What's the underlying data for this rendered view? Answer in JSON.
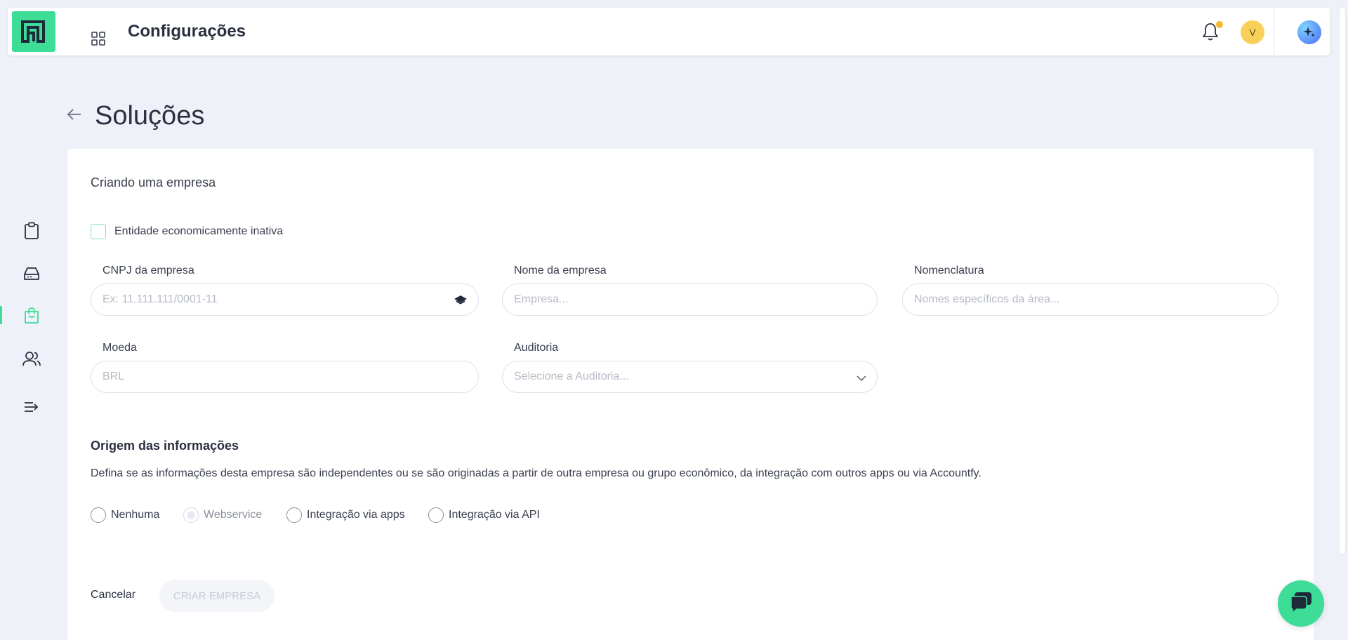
{
  "header": {
    "app_title": "Configurações",
    "avatar_initial": "V"
  },
  "page": {
    "title": "Soluções"
  },
  "form": {
    "subtitle": "Criando uma empresa",
    "inactive_checkbox_label": "Entidade economicamente inativa",
    "fields": {
      "cnpj": {
        "label": "CNPJ da empresa",
        "placeholder": "Ex: 11.111.111/0001-11"
      },
      "company_name": {
        "label": "Nome da empresa",
        "placeholder": "Empresa..."
      },
      "nomenclature": {
        "label": "Nomenclatura",
        "placeholder": "Nomes específicos da área..."
      },
      "currency": {
        "label": "Moeda",
        "placeholder": "BRL"
      },
      "audit": {
        "label": "Auditoria",
        "placeholder": "Selecione a Auditoria..."
      }
    },
    "origin": {
      "title": "Origem das informações",
      "description": "Defina se as informações desta empresa são independentes ou se são originadas a partir de outra empresa ou grupo econômico, da integração com outros apps ou via Accountfy.",
      "options": [
        "Nenhuma",
        "Webservice",
        "Integração via apps",
        "Integração via API"
      ]
    },
    "cancel_label": "Cancelar",
    "create_label": "CRIAR EMPRESA"
  },
  "colors": {
    "brand": "#3ddc97",
    "background": "#eef1f8",
    "notification_dot": "#f5b82e",
    "avatar_bg": "#f9d15a"
  },
  "icons": {
    "sidebar": [
      "clipboard-icon",
      "inbox-icon",
      "shopping-bag-icon",
      "users-icon",
      "list-arrow-icon"
    ],
    "header": [
      "apps-grid-icon",
      "bell-icon",
      "sparkle-icon"
    ]
  }
}
